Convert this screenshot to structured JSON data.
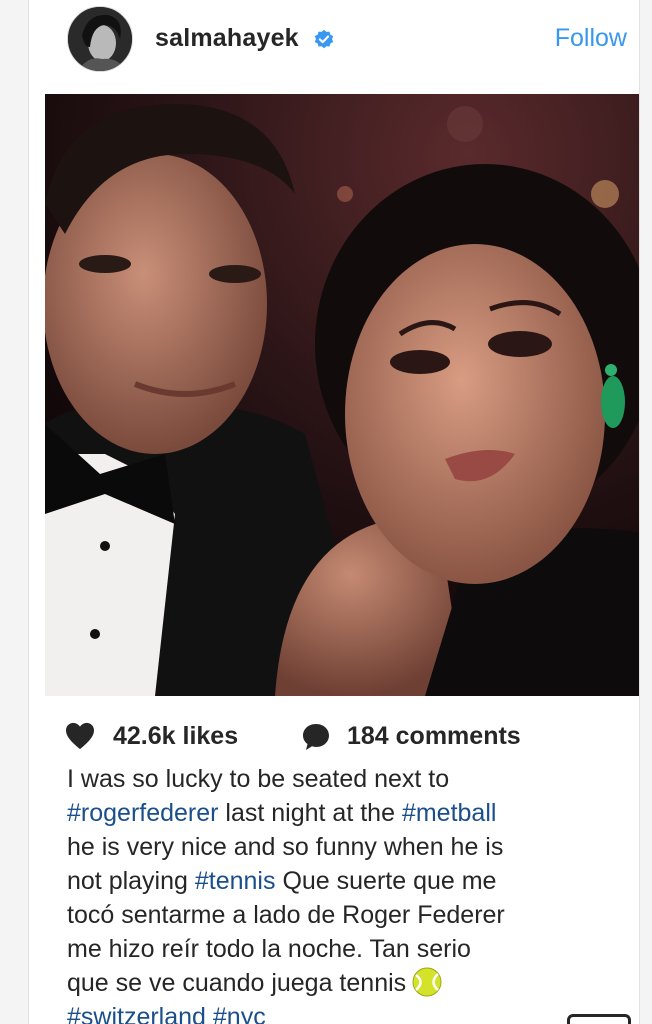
{
  "post": {
    "username": "salmahayek",
    "follow_label": "Follow",
    "likes": "42.6k likes",
    "comments": "184 comments"
  },
  "caption": {
    "lines": [
      [
        {
          "t": "I was so lucky to be seated next to",
          "tag": false
        }
      ],
      [
        {
          "t": "#rogerfederer",
          "tag": true
        },
        {
          "t": " last night at the ",
          "tag": false
        },
        {
          "t": "#metball",
          "tag": true
        }
      ],
      [
        {
          "t": "he is very nice and so funny when he is",
          "tag": false
        }
      ],
      [
        {
          "t": "not playing ",
          "tag": false
        },
        {
          "t": "#tennis",
          "tag": true
        },
        {
          "t": " Que suerte que me",
          "tag": false
        }
      ],
      [
        {
          "t": "tocó sentarme a lado de Roger Federer",
          "tag": false
        }
      ],
      [
        {
          "t": "me hizo reír todo la noche. Tan serio",
          "tag": false
        }
      ],
      [
        {
          "t": "que se ve cuando juega tennis",
          "tag": false
        }
      ],
      [
        {
          "t": "#switzerland",
          "tag": true
        },
        {
          "t": " ",
          "tag": false
        },
        {
          "t": "#nyc",
          "tag": true
        }
      ]
    ]
  },
  "icons": {
    "verified": "verified-badge-icon",
    "heart": "heart-icon",
    "comment": "comment-icon",
    "emoji": "tennis-ball-emoji-icon"
  },
  "colors": {
    "link": "#3897f0",
    "hashtag": "#1a4f8b",
    "text": "#262626"
  }
}
